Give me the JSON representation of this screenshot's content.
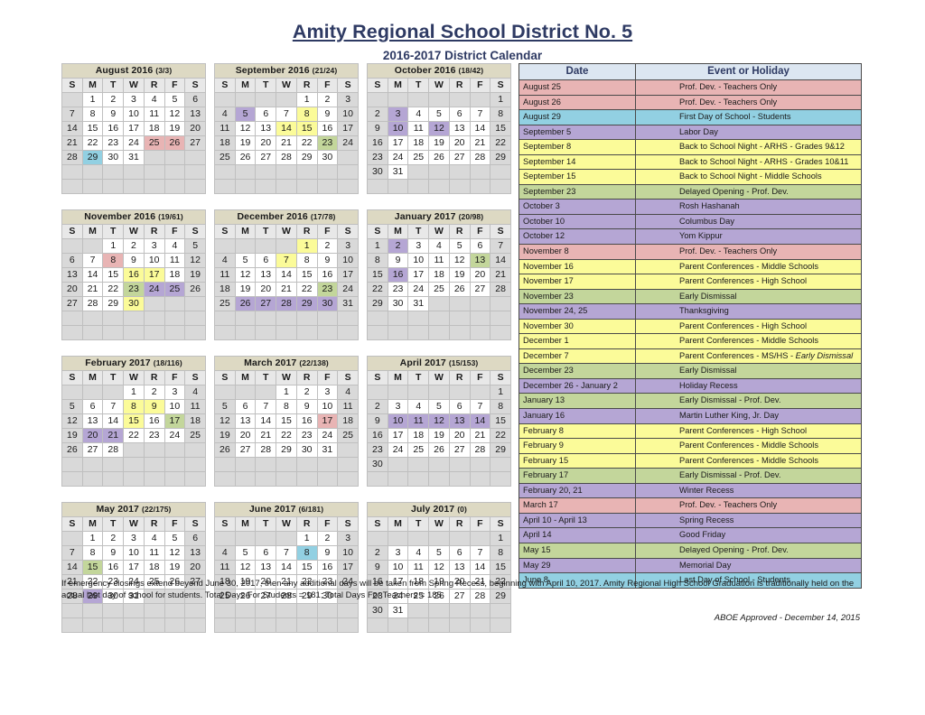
{
  "header": {
    "title": "Amity Regional School District No. 5",
    "subtitle": "2016-2017 District Calendar"
  },
  "dow": [
    "S",
    "M",
    "T",
    "W",
    "R",
    "F",
    "S"
  ],
  "colors": {
    "month_title_bg": "#ddd9c3",
    "events_header_bg": "#dce6f1",
    "title_text": "#2e3a63",
    "weekend_bg": "#d9d9d9",
    "pink": "#e8b4b4",
    "cyan": "#92d0e2",
    "purple": "#b5a6d4",
    "yellow": "#fbfb99",
    "green": "#c3d69b"
  },
  "months": [
    {
      "name": "August 2016",
      "count": "(3/3)",
      "first_dow": 1,
      "days": 31,
      "highlights": {
        "25": "pink",
        "26": "pink",
        "29": "cyan"
      }
    },
    {
      "name": "September 2016",
      "count": "(21/24)",
      "first_dow": 4,
      "days": 30,
      "highlights": {
        "5": "purple",
        "8": "yellow",
        "14": "yellow",
        "15": "yellow",
        "23": "green"
      }
    },
    {
      "name": "October 2016",
      "count": "(18/42)",
      "first_dow": 6,
      "days": 31,
      "highlights": {
        "3": "purple",
        "10": "purple",
        "12": "purple"
      }
    },
    {
      "name": "November 2016",
      "count": "(19/61)",
      "first_dow": 2,
      "days": 30,
      "highlights": {
        "8": "pink",
        "16": "yellow",
        "17": "yellow",
        "23": "green",
        "24": "purple",
        "25": "purple",
        "30": "yellow"
      }
    },
    {
      "name": "December 2016",
      "count": "(17/78)",
      "first_dow": 4,
      "days": 31,
      "highlights": {
        "1": "yellow",
        "7": "yellow",
        "23": "green",
        "26": "purple",
        "27": "purple",
        "28": "purple",
        "29": "purple",
        "30": "purple"
      }
    },
    {
      "name": "January 2017",
      "count": "(20/98)",
      "first_dow": 0,
      "days": 31,
      "highlights": {
        "2": "purple",
        "13": "green",
        "16": "purple"
      }
    },
    {
      "name": "February 2017",
      "count": "(18/116)",
      "first_dow": 3,
      "days": 28,
      "highlights": {
        "8": "yellow",
        "9": "yellow",
        "15": "yellow",
        "17": "green",
        "20": "purple",
        "21": "purple"
      }
    },
    {
      "name": "March 2017",
      "count": "(22/138)",
      "first_dow": 3,
      "days": 31,
      "highlights": {
        "17": "pink"
      }
    },
    {
      "name": "April 2017",
      "count": "(15/153)",
      "first_dow": 6,
      "days": 30,
      "highlights": {
        "10": "purple",
        "11": "purple",
        "12": "purple",
        "13": "purple",
        "14": "purple"
      }
    },
    {
      "name": "May 2017",
      "count": "(22/175)",
      "first_dow": 1,
      "days": 31,
      "highlights": {
        "15": "green",
        "29": "purple"
      }
    },
    {
      "name": "June 2017",
      "count": "(6/181)",
      "first_dow": 4,
      "days": 30,
      "highlights": {
        "8": "cyan"
      }
    },
    {
      "name": "July 2017",
      "count": "(0)",
      "first_dow": 6,
      "days": 31,
      "highlights": {}
    }
  ],
  "events": {
    "columns": [
      "Date",
      "Event or Holiday"
    ],
    "rows": [
      {
        "date": "August 25",
        "event": "Prof. Dev. - Teachers Only",
        "color": "pink"
      },
      {
        "date": "August 26",
        "event": "Prof. Dev. - Teachers Only",
        "color": "pink"
      },
      {
        "date": "August 29",
        "event": "First Day of School - Students",
        "color": "cyan"
      },
      {
        "date": "September 5",
        "event": "Labor Day",
        "color": "purple"
      },
      {
        "date": "September 8",
        "event": "Back to School Night - ARHS - Grades 9&12",
        "color": "yellow"
      },
      {
        "date": "September 14",
        "event": "Back to School Night - ARHS - Grades 10&11",
        "color": "yellow"
      },
      {
        "date": "September 15",
        "event": "Back to School Night - Middle Schools",
        "color": "yellow"
      },
      {
        "date": "September 23",
        "event": "Delayed Opening - Prof. Dev.",
        "color": "green"
      },
      {
        "date": "October 3",
        "event": "Rosh Hashanah",
        "color": "purple"
      },
      {
        "date": "October 10",
        "event": "Columbus Day",
        "color": "purple"
      },
      {
        "date": "October 12",
        "event": "Yom Kippur",
        "color": "purple"
      },
      {
        "date": "November 8",
        "event": "Prof. Dev. - Teachers Only",
        "color": "pink"
      },
      {
        "date": "November 16",
        "event": "Parent Conferences - Middle Schools",
        "color": "yellow"
      },
      {
        "date": "November 17",
        "event": "Parent Conferences - High School",
        "color": "yellow"
      },
      {
        "date": "November 23",
        "event": "Early Dismissal",
        "color": "green"
      },
      {
        "date": "November 24, 25",
        "event": "Thanksgiving",
        "color": "purple"
      },
      {
        "date": "November 30",
        "event": "Parent Conferences - High School",
        "color": "yellow"
      },
      {
        "date": "December 1",
        "event": "Parent Conferences - Middle Schools",
        "color": "yellow"
      },
      {
        "date": "December 7",
        "event": "Parent Conferences - MS/HS - Early Dismissal",
        "event_prefix": "Parent Conferences - MS/HS - ",
        "event_italic": "Early Dismissal",
        "color": "yellow"
      },
      {
        "date": "December 23",
        "event": "Early Dismissal",
        "color": "green"
      },
      {
        "date": "December 26 - January 2",
        "event": "Holiday Recess",
        "color": "purple"
      },
      {
        "date": "January 13",
        "event": "Early Dismissal - Prof. Dev.",
        "color": "green"
      },
      {
        "date": "January 16",
        "event": "Martin Luther King, Jr. Day",
        "color": "purple"
      },
      {
        "date": "February 8",
        "event": "Parent Conferences - High School",
        "color": "yellow"
      },
      {
        "date": "February 9",
        "event": "Parent Conferences - Middle Schools",
        "color": "yellow"
      },
      {
        "date": "February 15",
        "event": "Parent Conferences - Middle Schools",
        "color": "yellow"
      },
      {
        "date": "February 17",
        "event": "Early Dismissal - Prof. Dev.",
        "color": "green"
      },
      {
        "date": "February 20, 21",
        "event": "Winter Recess",
        "color": "purple"
      },
      {
        "date": "March 17",
        "event": "Prof. Dev. - Teachers Only",
        "color": "pink"
      },
      {
        "date": "April 10 - April 13",
        "event": "Spring Recess",
        "color": "purple"
      },
      {
        "date": "April 14",
        "event": "Good Friday",
        "color": "purple"
      },
      {
        "date": "May 15",
        "event": "Delayed Opening - Prof. Dev.",
        "color": "green"
      },
      {
        "date": "May 29",
        "event": "Memorial Day",
        "color": "purple"
      },
      {
        "date": "June 8",
        "event": "Last Day of School - Students",
        "color": "cyan"
      }
    ]
  },
  "footer": {
    "note": "If emergency closings extend beyond June 30, 2017, then any additional days will be taken from Spring Recess, beginning with April 10, 2017. Amity Regional High School Graduation is traditionally held on the actual last day of school for students. Total Days For Students = 181; Total Days For Teachers = 185",
    "approved": "ABOE Approved - December 14, 2015"
  }
}
